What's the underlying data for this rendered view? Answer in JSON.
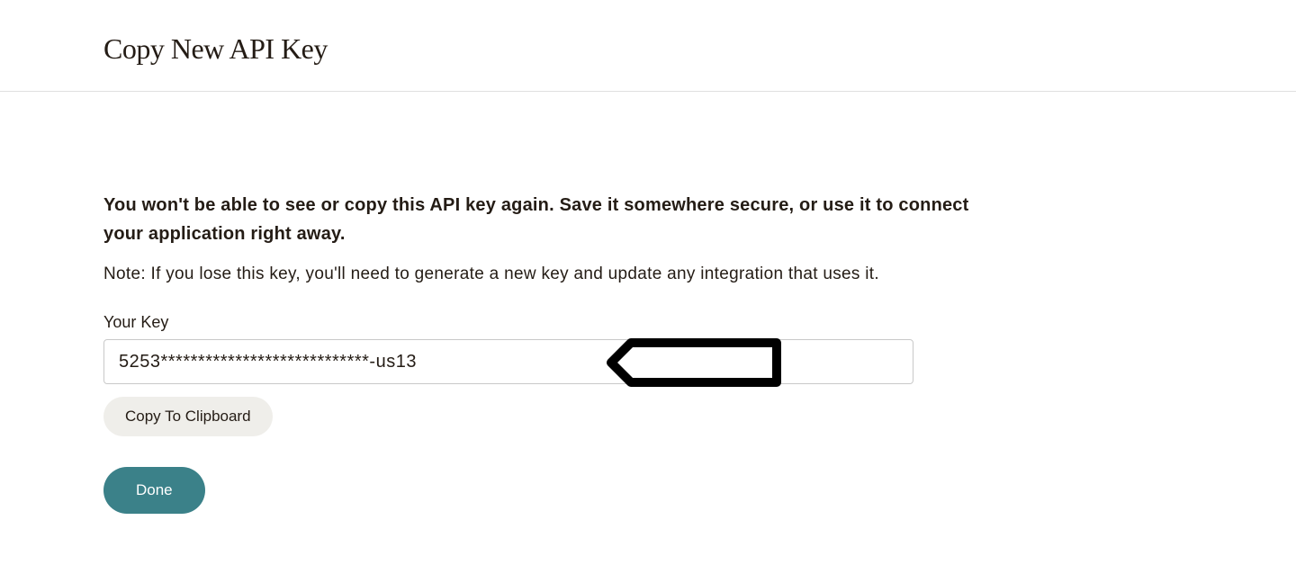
{
  "header": {
    "title": "Copy New API Key"
  },
  "content": {
    "warning": "You won't be able to see or copy this API key again. Save it somewhere secure, or use it to connect your application right away.",
    "note": "Note: If you lose this key, you'll need to generate a new key and update any integration that uses it.",
    "field_label": "Your Key",
    "api_key_value": "5253****************************-us13",
    "copy_button_label": "Copy To Clipboard",
    "done_button_label": "Done"
  }
}
